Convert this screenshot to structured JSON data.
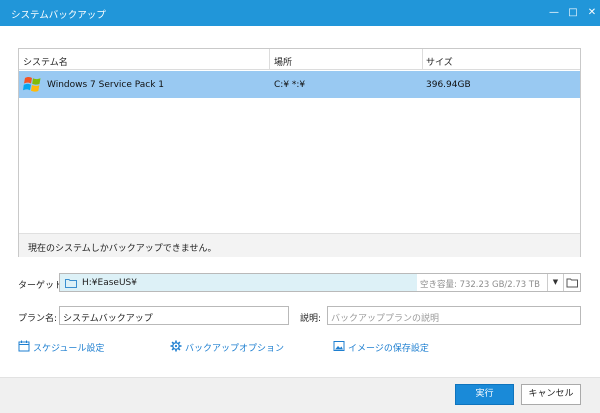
{
  "window": {
    "title": "システムバックアップ",
    "minimize_glyph": "—",
    "maximize_glyph": "□",
    "close_glyph": "✕"
  },
  "system_list": {
    "columns": [
      "システム名",
      "場所",
      "サイズ"
    ],
    "rows": [
      {
        "name": "Windows 7 Service Pack 1",
        "location": "C:¥ *:¥",
        "size": "396.94GB",
        "icon": "windows-logo-icon",
        "selected": true
      }
    ],
    "footer_note": "現在のシステムしかバックアップできません。"
  },
  "target": {
    "label": "ターゲット:",
    "path": "H:¥EaseUS¥",
    "free_space": "空き容量: 732.23 GB/2.73 TB",
    "dropdown_glyph": "▼",
    "icon": "folder-icon"
  },
  "plan": {
    "label": "プラン名:",
    "value": "システムバックアップ"
  },
  "description": {
    "label": "説明:",
    "placeholder": "バックアッププランの説明"
  },
  "links": {
    "schedule": "スケジュール設定",
    "options": "バックアップオプション",
    "image_settings": "イメージの保存設定"
  },
  "buttons": {
    "run": "実行",
    "cancel": "キャンセル"
  },
  "colors": {
    "titlebar": "#2196d9",
    "selected_row": "#99c9f2",
    "target_bg": "#ddf1f7",
    "link": "#1e7fd0",
    "primary_button": "#1a8ad8"
  }
}
